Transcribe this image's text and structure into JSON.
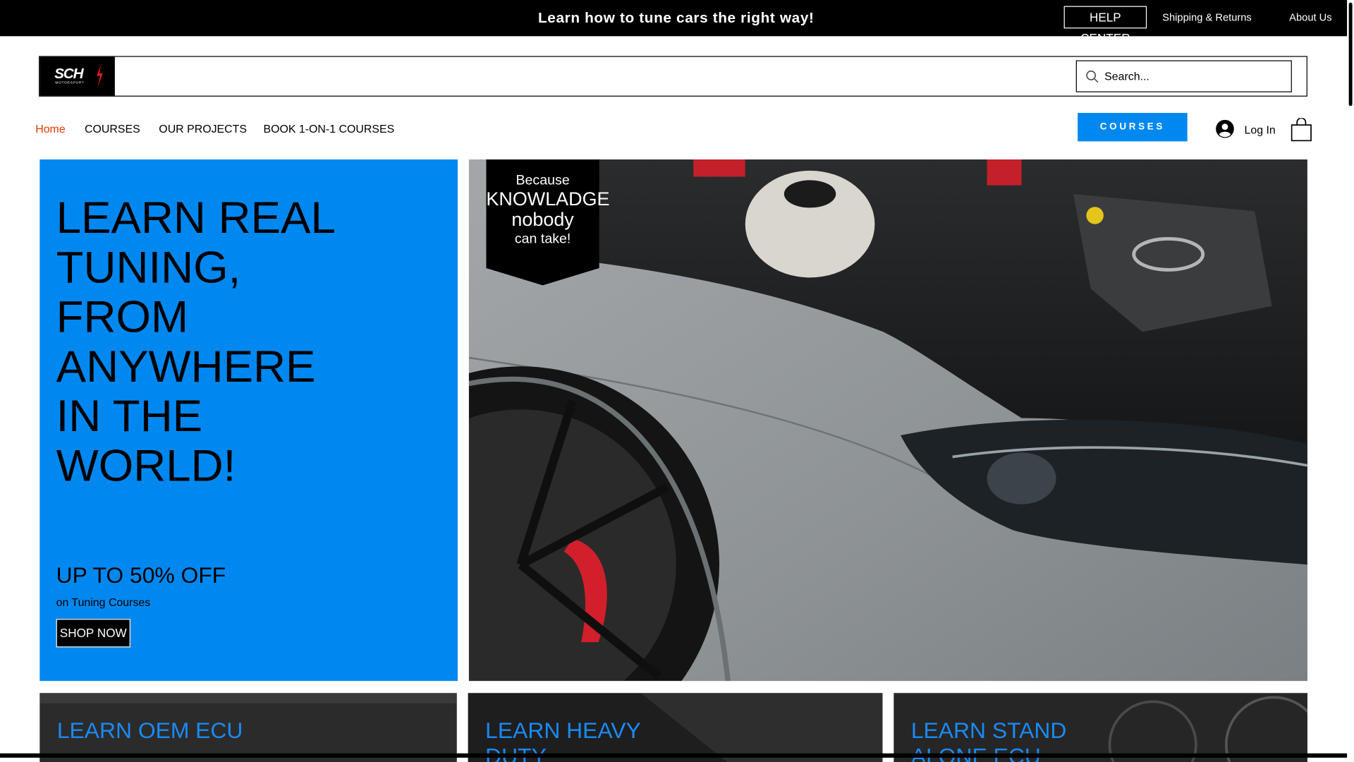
{
  "topbar": {
    "promo": "Learn how to tune cars the right way!",
    "help_center": "HELP CENTER",
    "shipping_returns": "Shipping & Returns",
    "about_us": "About Us"
  },
  "header": {
    "logo_text": "SCH",
    "logo_sub": "MOTORSPORT",
    "search_placeholder": "Search..."
  },
  "nav": {
    "items": [
      {
        "label": "Home",
        "active": true
      },
      {
        "label": "COURSES",
        "active": false
      },
      {
        "label": "OUR PROJECTS",
        "active": false
      },
      {
        "label": "BOOK 1-ON-1 COURSES",
        "active": false
      }
    ],
    "courses_button": "COURSES",
    "login": "Log In"
  },
  "hero": {
    "title": "LEARN REAL TUNING, FROM ANYWHERE IN THE WORLD!",
    "sale": "UP TO 50% OFF",
    "sale_sub": "on Tuning Courses",
    "shop_button": "SHOP NOW",
    "badge": {
      "line1": "Because",
      "line2": "KNOWLADGE nobody",
      "line3": "can take!"
    }
  },
  "cards": [
    {
      "title": "LEARN OEM ECU"
    },
    {
      "title": "LEARN HEAVY DUTY"
    },
    {
      "title": "LEARN STAND ALONE ECU"
    }
  ],
  "colors": {
    "accent": "#0088f0",
    "active_nav": "#e03a00",
    "card_title": "#1a8af5"
  }
}
